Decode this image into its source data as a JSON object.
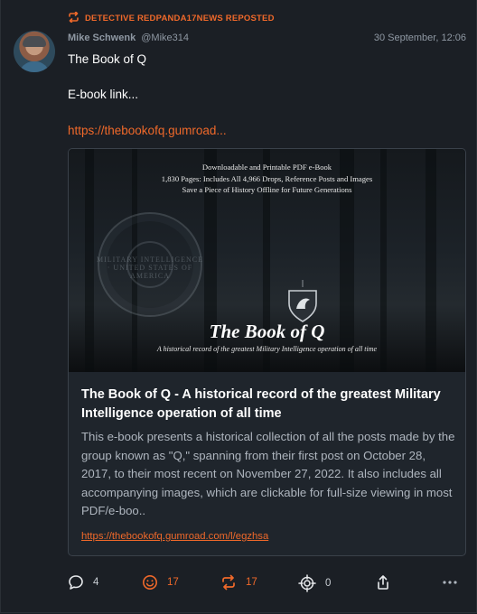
{
  "repost": {
    "label": "DETECTIVE REDPANDA17NEWS REPOSTED"
  },
  "author": {
    "name": "Mike Schwenk",
    "handle": "@Mike314",
    "timestamp": "30 September, 12:06"
  },
  "post": {
    "line1": "The Book of Q",
    "line2": "E-book link...",
    "link": "https://thebookofq.gumroad..."
  },
  "card": {
    "image_lines": [
      "Downloadable and Printable PDF e-Book",
      "1,830 Pages: Includes All 4,966 Drops, Reference Posts and Images",
      "Save a Piece of History Offline for Future Generations"
    ],
    "image_title": "The Book of Q",
    "image_subtitle": "A historical record of the greatest Military Intelligence operation of all time",
    "seal_text": "MILITARY INTELLIGENCE · UNITED STATES OF AMERICA",
    "title": "The Book of Q - A historical record of the greatest Military Intelligence operation of all time",
    "description": "This e-book presents a historical collection of all the posts made by the group known as \"Q,\" spanning from their first post on October 28, 2017, to their most recent on November 27, 2022. It also includes all accompanying images, which are clickable for full-size viewing in most PDF/e-boo..",
    "url": "https://thebookofq.gumroad.com/l/egzhsa"
  },
  "actions": {
    "replies": "4",
    "reactions": "17",
    "reposts": "17",
    "targets": "0"
  },
  "colors": {
    "accent": "#f0692a",
    "background": "#1b1f25",
    "muted": "#8f98a3"
  },
  "icons": [
    "repost-icon",
    "reply-icon",
    "smiley-icon",
    "target-icon",
    "share-icon",
    "more-icon"
  ]
}
